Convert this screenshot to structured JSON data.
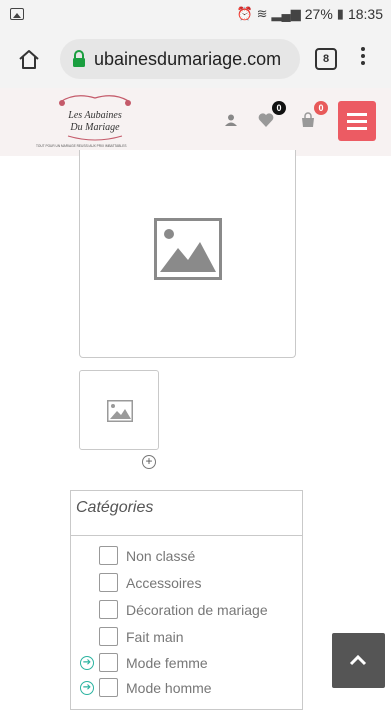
{
  "status_bar": {
    "battery": "27%",
    "time": "18:35"
  },
  "browser": {
    "url": "ubainesdumariage.com",
    "tab_count": "8"
  },
  "site_header": {
    "logo_text": "Les Aubaines Du Mariage",
    "logo_tagline": "TOUT POUR UN MARIAGE REUSSI AUX PRIX IMBATTABLES",
    "wishlist_count": "0",
    "cart_count": "0"
  },
  "categories": {
    "title": "Catégories",
    "items": [
      {
        "label": "Non classé",
        "expandable": false
      },
      {
        "label": "Accessoires",
        "expandable": false
      },
      {
        "label": "Décoration de mariage",
        "expandable": false
      },
      {
        "label": "Fait main",
        "expandable": false
      },
      {
        "label": "Mode femme",
        "expandable": true
      },
      {
        "label": "Mode homme",
        "expandable": true
      }
    ]
  },
  "colors": {
    "accent": "#ec5b63",
    "teal": "#2bb3a0",
    "totop_bg": "#555555"
  }
}
